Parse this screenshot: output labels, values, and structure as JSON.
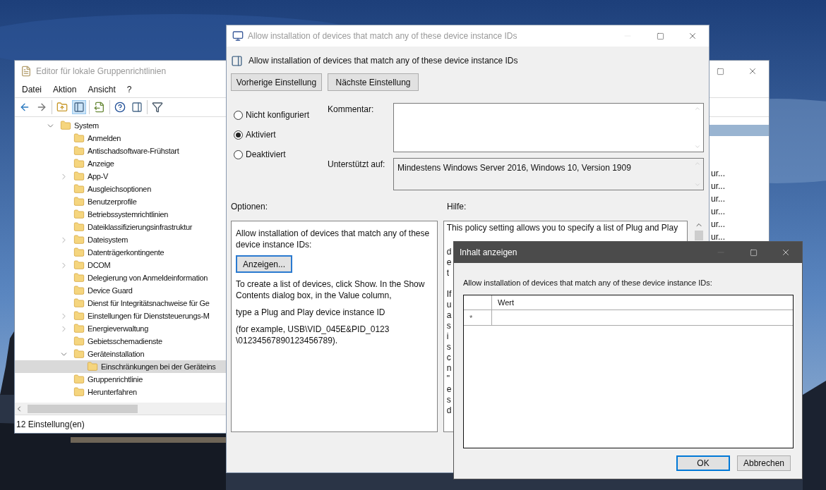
{
  "editor_window": {
    "title": "Editor für lokale Gruppenrichtlinien",
    "menu": [
      "Datei",
      "Aktion",
      "Ansicht",
      "?"
    ],
    "tree": [
      {
        "label": "System",
        "has_children": true,
        "expanded": true,
        "selected": false,
        "children": [
          {
            "label": "Anmelden",
            "has_children": false,
            "expanded": false,
            "selected": false
          },
          {
            "label": "Antischadsoftware-Frühstart",
            "has_children": false,
            "expanded": false,
            "selected": false
          },
          {
            "label": "Anzeige",
            "has_children": false,
            "expanded": false,
            "selected": false
          },
          {
            "label": "App-V",
            "has_children": true,
            "expanded": false,
            "selected": false
          },
          {
            "label": "Ausgleichsoptionen",
            "has_children": false,
            "expanded": false,
            "selected": false
          },
          {
            "label": "Benutzerprofile",
            "has_children": false,
            "expanded": false,
            "selected": false
          },
          {
            "label": "Betriebssystemrichtlinien",
            "has_children": false,
            "expanded": false,
            "selected": false
          },
          {
            "label": "Dateiklassifizierungsinfrastruktur",
            "has_children": false,
            "expanded": false,
            "selected": false
          },
          {
            "label": "Dateisystem",
            "has_children": true,
            "expanded": false,
            "selected": false
          },
          {
            "label": "Datenträgerkontingente",
            "has_children": false,
            "expanded": false,
            "selected": false
          },
          {
            "label": "DCOM",
            "has_children": true,
            "expanded": false,
            "selected": false
          },
          {
            "label": "Delegierung von Anmeldeinformation",
            "has_children": false,
            "expanded": false,
            "selected": false
          },
          {
            "label": "Device Guard",
            "has_children": false,
            "expanded": false,
            "selected": false
          },
          {
            "label": "Dienst für Integritätsnachweise für Ge",
            "has_children": false,
            "expanded": false,
            "selected": false
          },
          {
            "label": "Einstellungen für Dienststeuerungs-M",
            "has_children": true,
            "expanded": false,
            "selected": false
          },
          {
            "label": "Energieverwaltung",
            "has_children": true,
            "expanded": false,
            "selected": false
          },
          {
            "label": "Gebietsschemadienste",
            "has_children": false,
            "expanded": false,
            "selected": false
          },
          {
            "label": "Geräteinstallation",
            "has_children": true,
            "expanded": true,
            "selected": false,
            "children": [
              {
                "label": "Einschränkungen bei der Geräteins",
                "has_children": false,
                "expanded": false,
                "selected": true
              }
            ]
          },
          {
            "label": "Gruppenrichtlinie",
            "has_children": false,
            "expanded": false,
            "selected": false
          },
          {
            "label": "Herunterfahren",
            "has_children": false,
            "expanded": false,
            "selected": false
          }
        ]
      }
    ],
    "list_fragments": [
      "ur...",
      "ur...",
      "ur...",
      "ur...",
      "ur...",
      "ur..."
    ],
    "status_bar": "12 Einstellung(en)"
  },
  "policy_dialog": {
    "title": "Allow installation of devices that match any of these device instance IDs",
    "heading": "Allow installation of devices that match any of these device instance IDs",
    "nav_buttons": [
      "Vorherige Einstellung",
      "Nächste Einstellung"
    ],
    "states": [
      {
        "label": "Nicht konfiguriert",
        "selected": false
      },
      {
        "label": "Aktiviert",
        "selected": true
      },
      {
        "label": "Deaktiviert",
        "selected": false
      }
    ],
    "comment_label": "Kommentar:",
    "supported_label": "Unterstützt auf:",
    "supported_value": "Mindestens Windows Server 2016, Windows 10, Version 1909",
    "options_label": "Optionen:",
    "help_label": "Hilfe:",
    "options": {
      "description": "Allow installation of devices that match any of these device instance IDs:",
      "show_button": "Anzeigen...",
      "paragraphs": [
        "To create a list of devices, click Show. In the Show Contents dialog box, in the Value column,",
        "type a Plug and Play device instance ID",
        "(for example, USB\\VID_045E&PID_0123 \\01234567890123456789)."
      ]
    },
    "help_first_line": "This policy setting allows you to specify a list of Plug and Play",
    "help_paragraphs": [
      {
        "lines": [
          "d",
          "e",
          "t"
        ]
      },
      {
        "lines": [
          "If",
          "u",
          "a",
          "s",
          "i",
          "s",
          "c",
          "n",
          "\"",
          "e",
          "s",
          "d"
        ]
      }
    ]
  },
  "show_contents_dialog": {
    "title": "Inhalt anzeigen",
    "prompt": "Allow installation of devices that match any of these device instance IDs:",
    "columns": [
      "Wert"
    ],
    "new_row_marker": "*",
    "buttons": [
      {
        "label": "OK",
        "default": true
      },
      {
        "label": "Abbrechen",
        "default": false
      }
    ]
  }
}
